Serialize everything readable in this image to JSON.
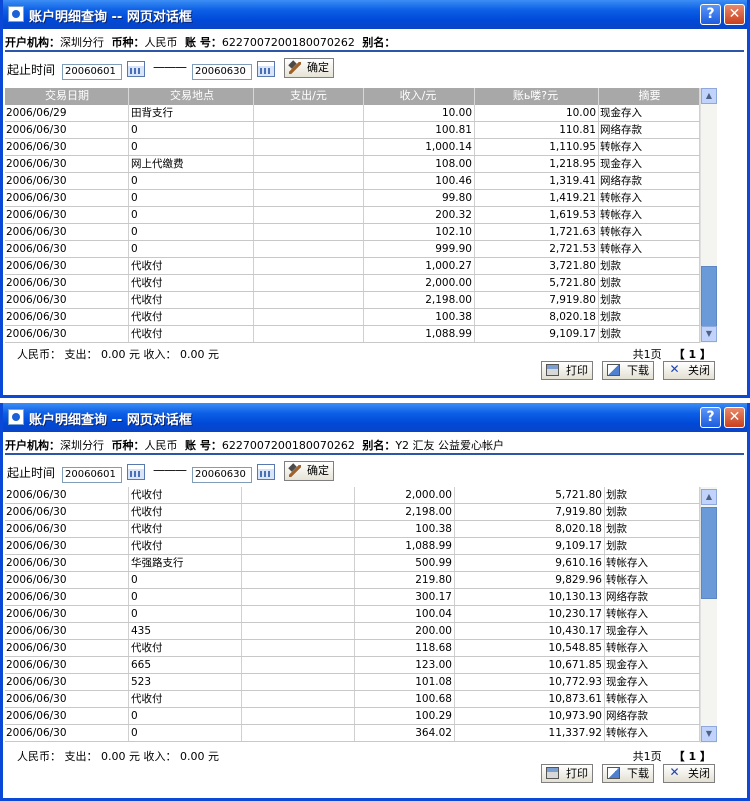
{
  "windows": [
    {
      "title": "账户明细查询 -- 网页对话框",
      "info": {
        "branch_label": "开户机构：",
        "branch": "深圳分行",
        "currency_label": "币种：",
        "currency": "人民币",
        "account_label": "账 号：",
        "account": "6227007200180070262",
        "alias_label": "别名：",
        "alias": ""
      },
      "date_label": "起止时间",
      "start_date": "20060601",
      "dash": "———",
      "end_date": "20060630",
      "confirm_label": "确定",
      "headers": [
        "交易日期",
        "交易地点",
        "支出/元",
        "收入/元",
        "账ь喽?元",
        "摘要"
      ],
      "rows": [
        [
          "2006/06/29",
          "田背支行",
          "",
          "10.00",
          "10.00",
          "现金存入"
        ],
        [
          "2006/06/30",
          "0",
          "",
          "100.81",
          "110.81",
          "网络存款"
        ],
        [
          "2006/06/30",
          "0",
          "",
          "1,000.14",
          "1,110.95",
          "转帐存入"
        ],
        [
          "2006/06/30",
          "网上代缴费",
          "",
          "108.00",
          "1,218.95",
          "现金存入"
        ],
        [
          "2006/06/30",
          "0",
          "",
          "100.46",
          "1,319.41",
          "网络存款"
        ],
        [
          "2006/06/30",
          "0",
          "",
          "99.80",
          "1,419.21",
          "转帐存入"
        ],
        [
          "2006/06/30",
          "0",
          "",
          "200.32",
          "1,619.53",
          "转帐存入"
        ],
        [
          "2006/06/30",
          "0",
          "",
          "102.10",
          "1,721.63",
          "转帐存入"
        ],
        [
          "2006/06/30",
          "0",
          "",
          "999.90",
          "2,721.53",
          "转帐存入"
        ],
        [
          "2006/06/30",
          "代收付",
          "",
          "1,000.27",
          "3,721.80",
          "划款"
        ],
        [
          "2006/06/30",
          "代收付",
          "",
          "2,000.00",
          "5,721.80",
          "划款"
        ],
        [
          "2006/06/30",
          "代收付",
          "",
          "2,198.00",
          "7,919.80",
          "划款"
        ],
        [
          "2006/06/30",
          "代收付",
          "",
          "100.38",
          "8,020.18",
          "划款"
        ],
        [
          "2006/06/30",
          "代收付",
          "",
          "1,088.99",
          "9,109.17",
          "划款"
        ]
      ],
      "summary": "人民币： 支出： 0.00 元   收入： 0.00 元",
      "page_info": "共1页",
      "page_num": "【 1 】",
      "buttons": {
        "print": "打印",
        "download": "下载",
        "close": "关闭"
      }
    },
    {
      "title": "账户明细查询 -- 网页对话框",
      "info": {
        "branch_label": "开户机构：",
        "branch": "深圳分行",
        "currency_label": "币种：",
        "currency": "人民币",
        "account_label": "账 号：",
        "account": "6227007200180070262",
        "alias_label": "别名：",
        "alias": "Y2 汇友 公益爱心帐户"
      },
      "date_label": "起止时间",
      "start_date": "20060601",
      "dash": "———",
      "end_date": "20060630",
      "confirm_label": "确定",
      "rows": [
        [
          "2006/06/30",
          "代收付",
          "",
          "2,000.00",
          "5,721.80",
          "划款"
        ],
        [
          "2006/06/30",
          "代收付",
          "",
          "2,198.00",
          "7,919.80",
          "划款"
        ],
        [
          "2006/06/30",
          "代收付",
          "",
          "100.38",
          "8,020.18",
          "划款"
        ],
        [
          "2006/06/30",
          "代收付",
          "",
          "1,088.99",
          "9,109.17",
          "划款"
        ],
        [
          "2006/06/30",
          "华强路支行",
          "",
          "500.99",
          "9,610.16",
          "转帐存入"
        ],
        [
          "2006/06/30",
          "0",
          "",
          "219.80",
          "9,829.96",
          "转帐存入"
        ],
        [
          "2006/06/30",
          "0",
          "",
          "300.17",
          "10,130.13",
          "网络存款"
        ],
        [
          "2006/06/30",
          "0",
          "",
          "100.04",
          "10,230.17",
          "转帐存入"
        ],
        [
          "2006/06/30",
          "435",
          "",
          "200.00",
          "10,430.17",
          "现金存入"
        ],
        [
          "2006/06/30",
          "代收付",
          "",
          "118.68",
          "10,548.85",
          "转帐存入"
        ],
        [
          "2006/06/30",
          "665",
          "",
          "123.00",
          "10,671.85",
          "现金存入"
        ],
        [
          "2006/06/30",
          "523",
          "",
          "101.08",
          "10,772.93",
          "现金存入"
        ],
        [
          "2006/06/30",
          "代收付",
          "",
          "100.68",
          "10,873.61",
          "转帐存入"
        ],
        [
          "2006/06/30",
          "0",
          "",
          "100.29",
          "10,973.90",
          "网络存款"
        ],
        [
          "2006/06/30",
          "0",
          "",
          "364.02",
          "11,337.92",
          "转帐存入"
        ]
      ],
      "summary": "人民币： 支出： 0.00 元   收入： 0.00 元",
      "page_info": "共1页",
      "page_num": "【 1 】",
      "buttons": {
        "print": "打印",
        "download": "下载",
        "close": "关闭"
      }
    }
  ]
}
